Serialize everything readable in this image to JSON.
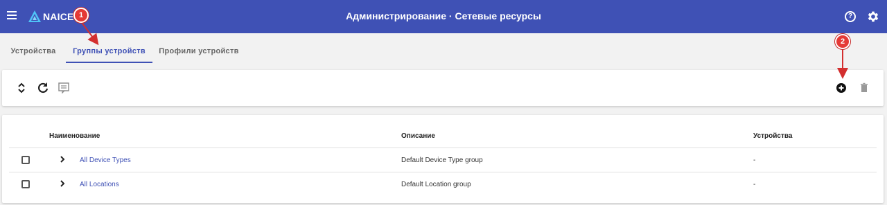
{
  "header": {
    "app_name": "NAICE",
    "title": "Администрирование · Сетевые ресурсы",
    "help_symbol": "?"
  },
  "tabs": [
    {
      "label": "Устройства",
      "active": false
    },
    {
      "label": "Группы устройств",
      "active": true
    },
    {
      "label": "Профили устройств",
      "active": false
    }
  ],
  "toolbar": {
    "left_icons": [
      "expand-collapse-icon",
      "refresh-icon",
      "comment-icon"
    ],
    "right_icons": [
      "add-circle-icon",
      "delete-icon"
    ]
  },
  "table": {
    "columns": [
      "Наименование",
      "Описание",
      "Устройства"
    ],
    "rows": [
      {
        "name": "All Device Types",
        "description": "Default Device Type group",
        "devices": "-"
      },
      {
        "name": "All Locations",
        "description": "Default Location group",
        "devices": "-"
      }
    ]
  },
  "annotations": [
    {
      "label": "1",
      "color": "#e53935"
    },
    {
      "label": "2",
      "color": "#e53935"
    }
  ]
}
